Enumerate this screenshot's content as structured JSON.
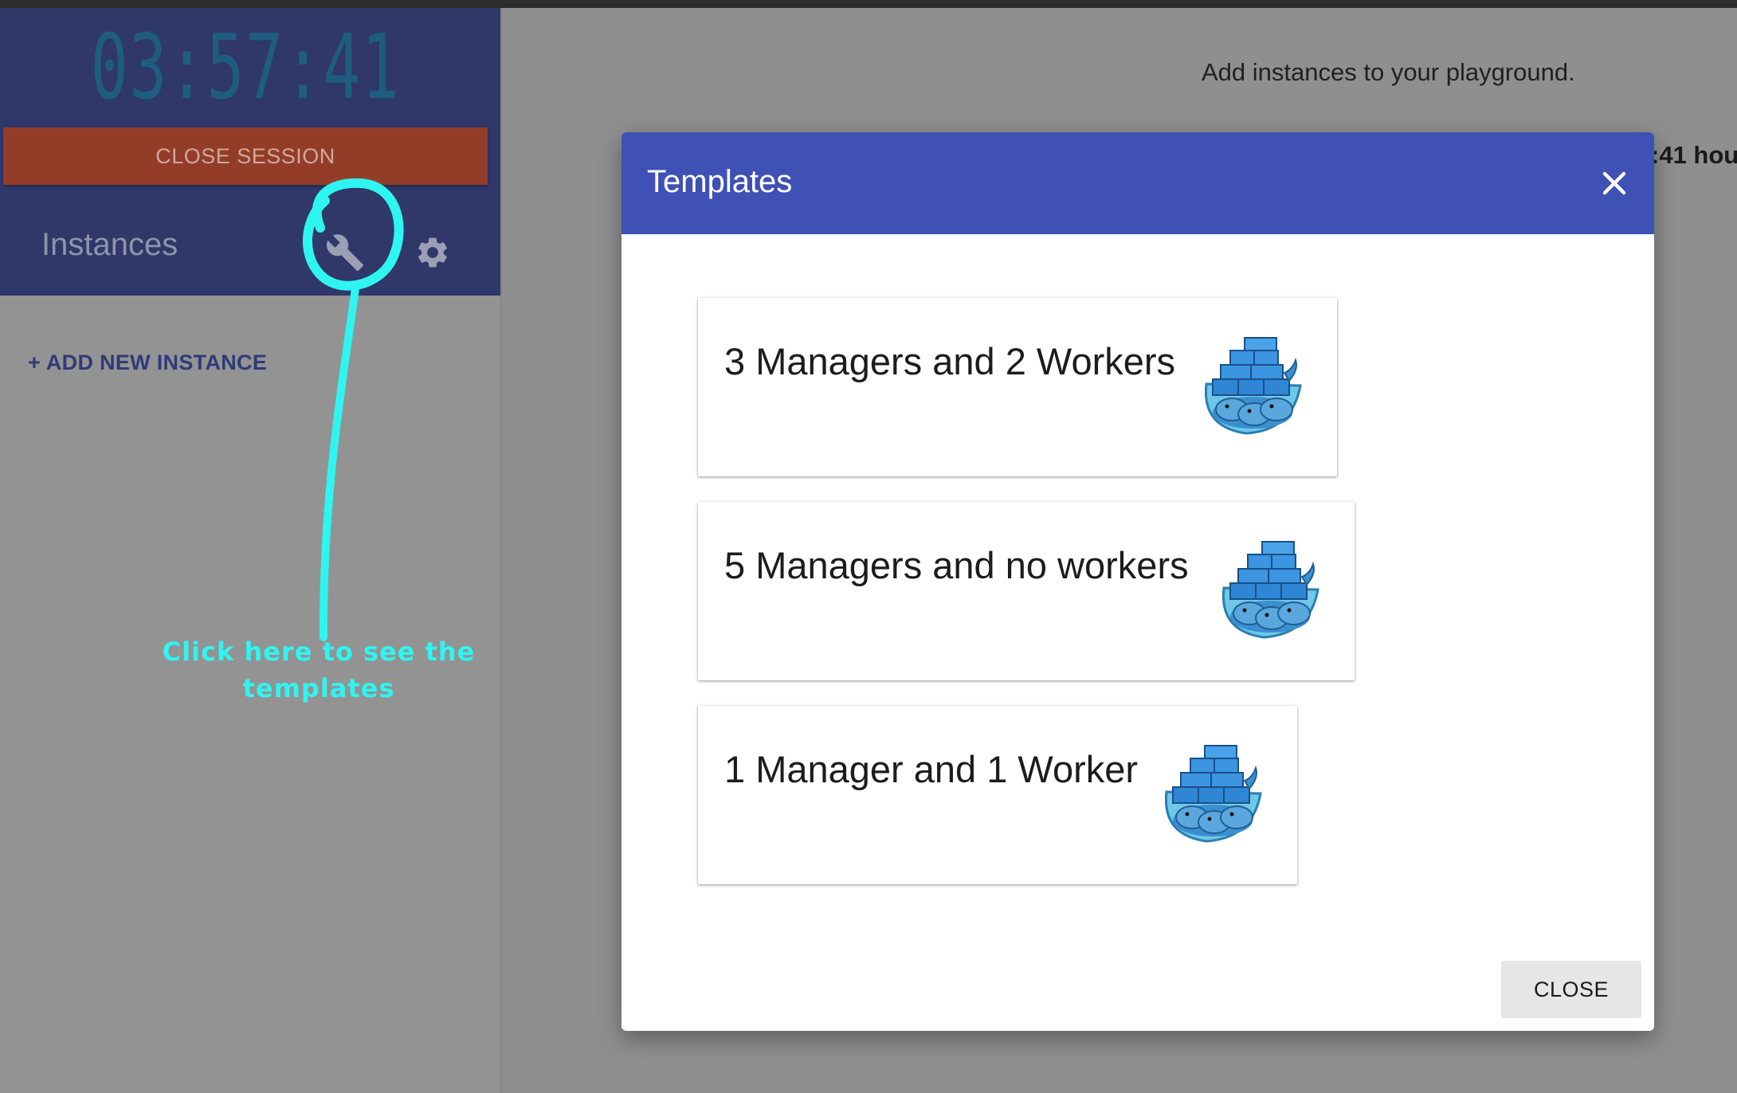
{
  "sidebar": {
    "timer": "03:57:41",
    "close_session_label": "CLOSE SESSION",
    "instances_title": "Instances",
    "add_instance_label": "+ ADD NEW INSTANCE",
    "icons": [
      "wrench-icon",
      "gear-icon"
    ]
  },
  "main": {
    "message": "Add instances to your playground.",
    "hours_text": ":41 hou"
  },
  "annotation": {
    "line1": "Click here to see the",
    "line2": "templates",
    "color": "#2ff5f0"
  },
  "dialog": {
    "title": "Templates",
    "close_icon": "close-icon",
    "templates": [
      {
        "label": "3 Managers and 2 Workers",
        "image": "docker-swarm-whale"
      },
      {
        "label": "5 Managers and no workers",
        "image": "docker-swarm-whale"
      },
      {
        "label": "1 Manager and 1 Worker",
        "image": "docker-swarm-whale"
      }
    ],
    "close_button_label": "CLOSE"
  },
  "colors": {
    "sidebar_header": "#2f3869",
    "close_session": "#933d28",
    "dialog_header": "#3f51b5",
    "backdrop": "#8f8f8f"
  }
}
